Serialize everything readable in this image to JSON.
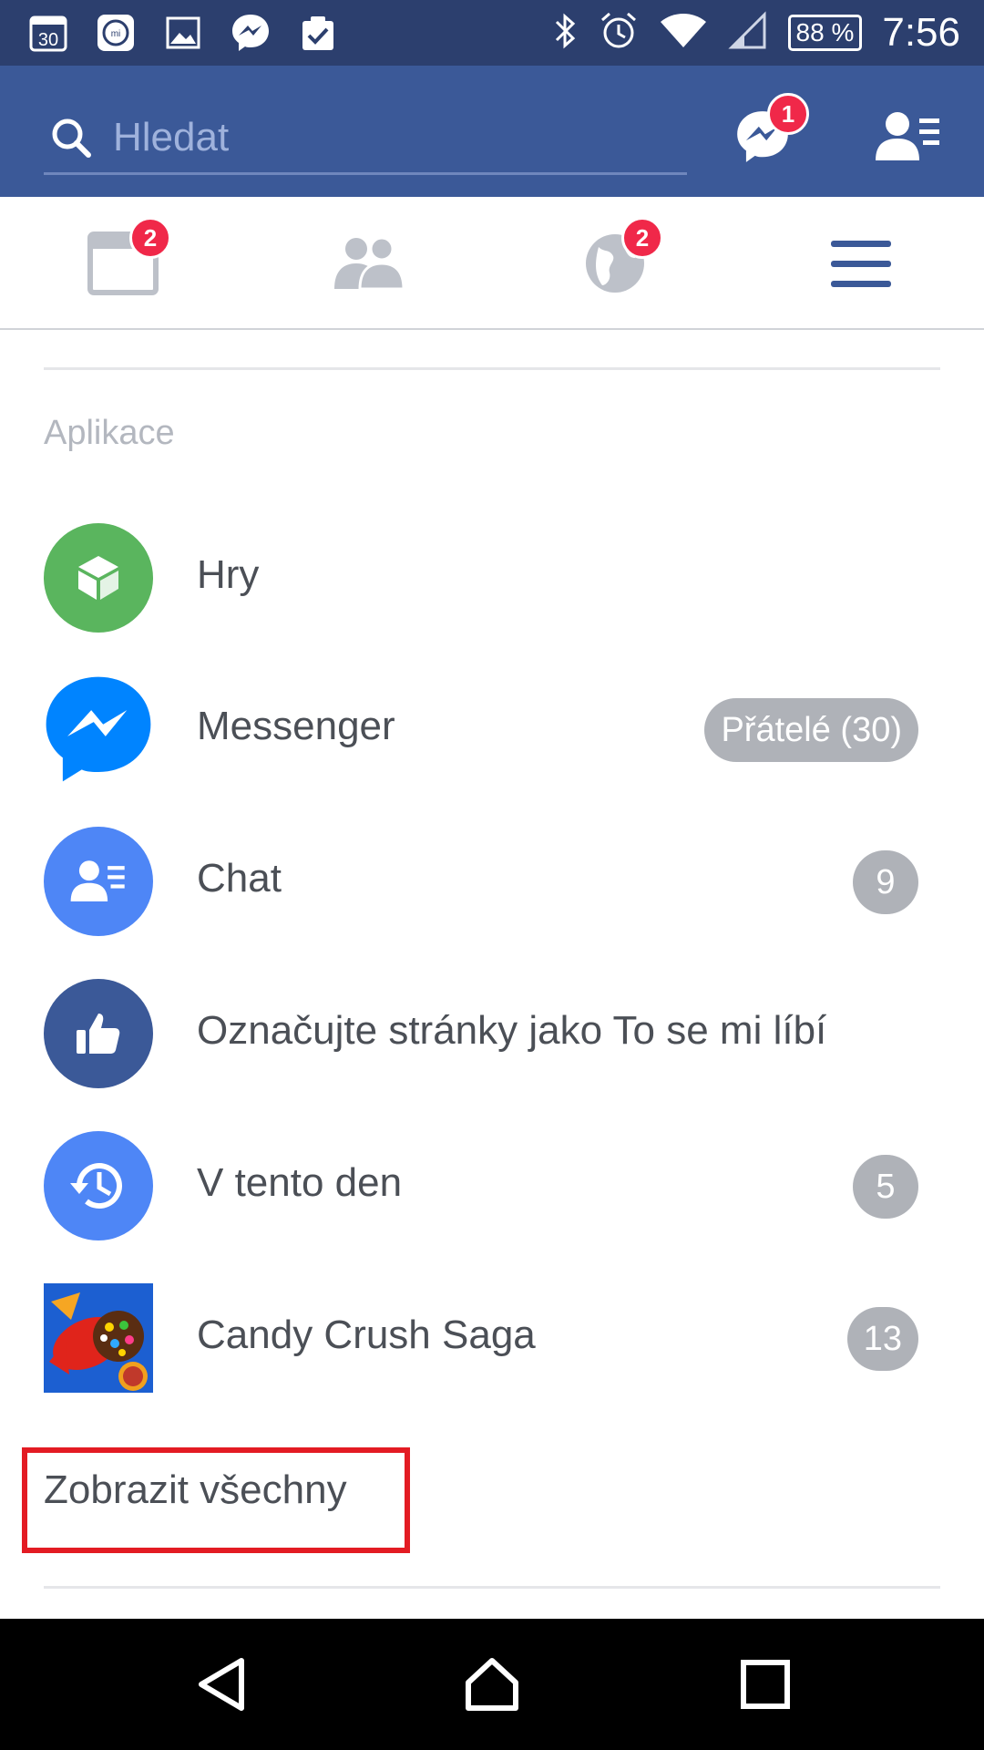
{
  "status_bar": {
    "notif_icons": [
      "calendar-icon",
      "mi-icon",
      "gallery-icon",
      "messenger-icon",
      "clipboard-check-icon"
    ],
    "calendar_day": "30",
    "battery_percent": "88 %",
    "time": "7:56"
  },
  "header": {
    "search_placeholder": "Hledat",
    "messenger_badge": "1"
  },
  "tabs": {
    "news_feed_badge": "2",
    "notifications_badge": "2"
  },
  "section": {
    "title": "Aplikace"
  },
  "apps": [
    {
      "label": "Hry",
      "icon": "cube-icon",
      "color": "#5ab55e",
      "count": ""
    },
    {
      "label": "Messenger",
      "icon": "messenger-icon",
      "color": "#0084ff",
      "count": "Přátelé (30)"
    },
    {
      "label": "Chat",
      "icon": "contacts-icon",
      "color": "#4e86f6",
      "count": "9"
    },
    {
      "label": "Označujte stránky jako To se mi líbí",
      "icon": "thumbs-up-icon",
      "color": "#3b5998",
      "count": ""
    },
    {
      "label": "V tento den",
      "icon": "history-icon",
      "color": "#4e86f6",
      "count": "5"
    },
    {
      "label": "Candy Crush Saga",
      "icon": "candy-crush-icon",
      "color": "#1c5fd1",
      "count": "13"
    }
  ],
  "see_all": {
    "label": "Zobrazit všechny",
    "highlight_color": "#e31b23"
  },
  "colors": {
    "facebook_blue": "#3b5998",
    "status_bar": "#2c3f6e",
    "badge_red": "#f02849",
    "pill_gray": "#afb2b8"
  }
}
